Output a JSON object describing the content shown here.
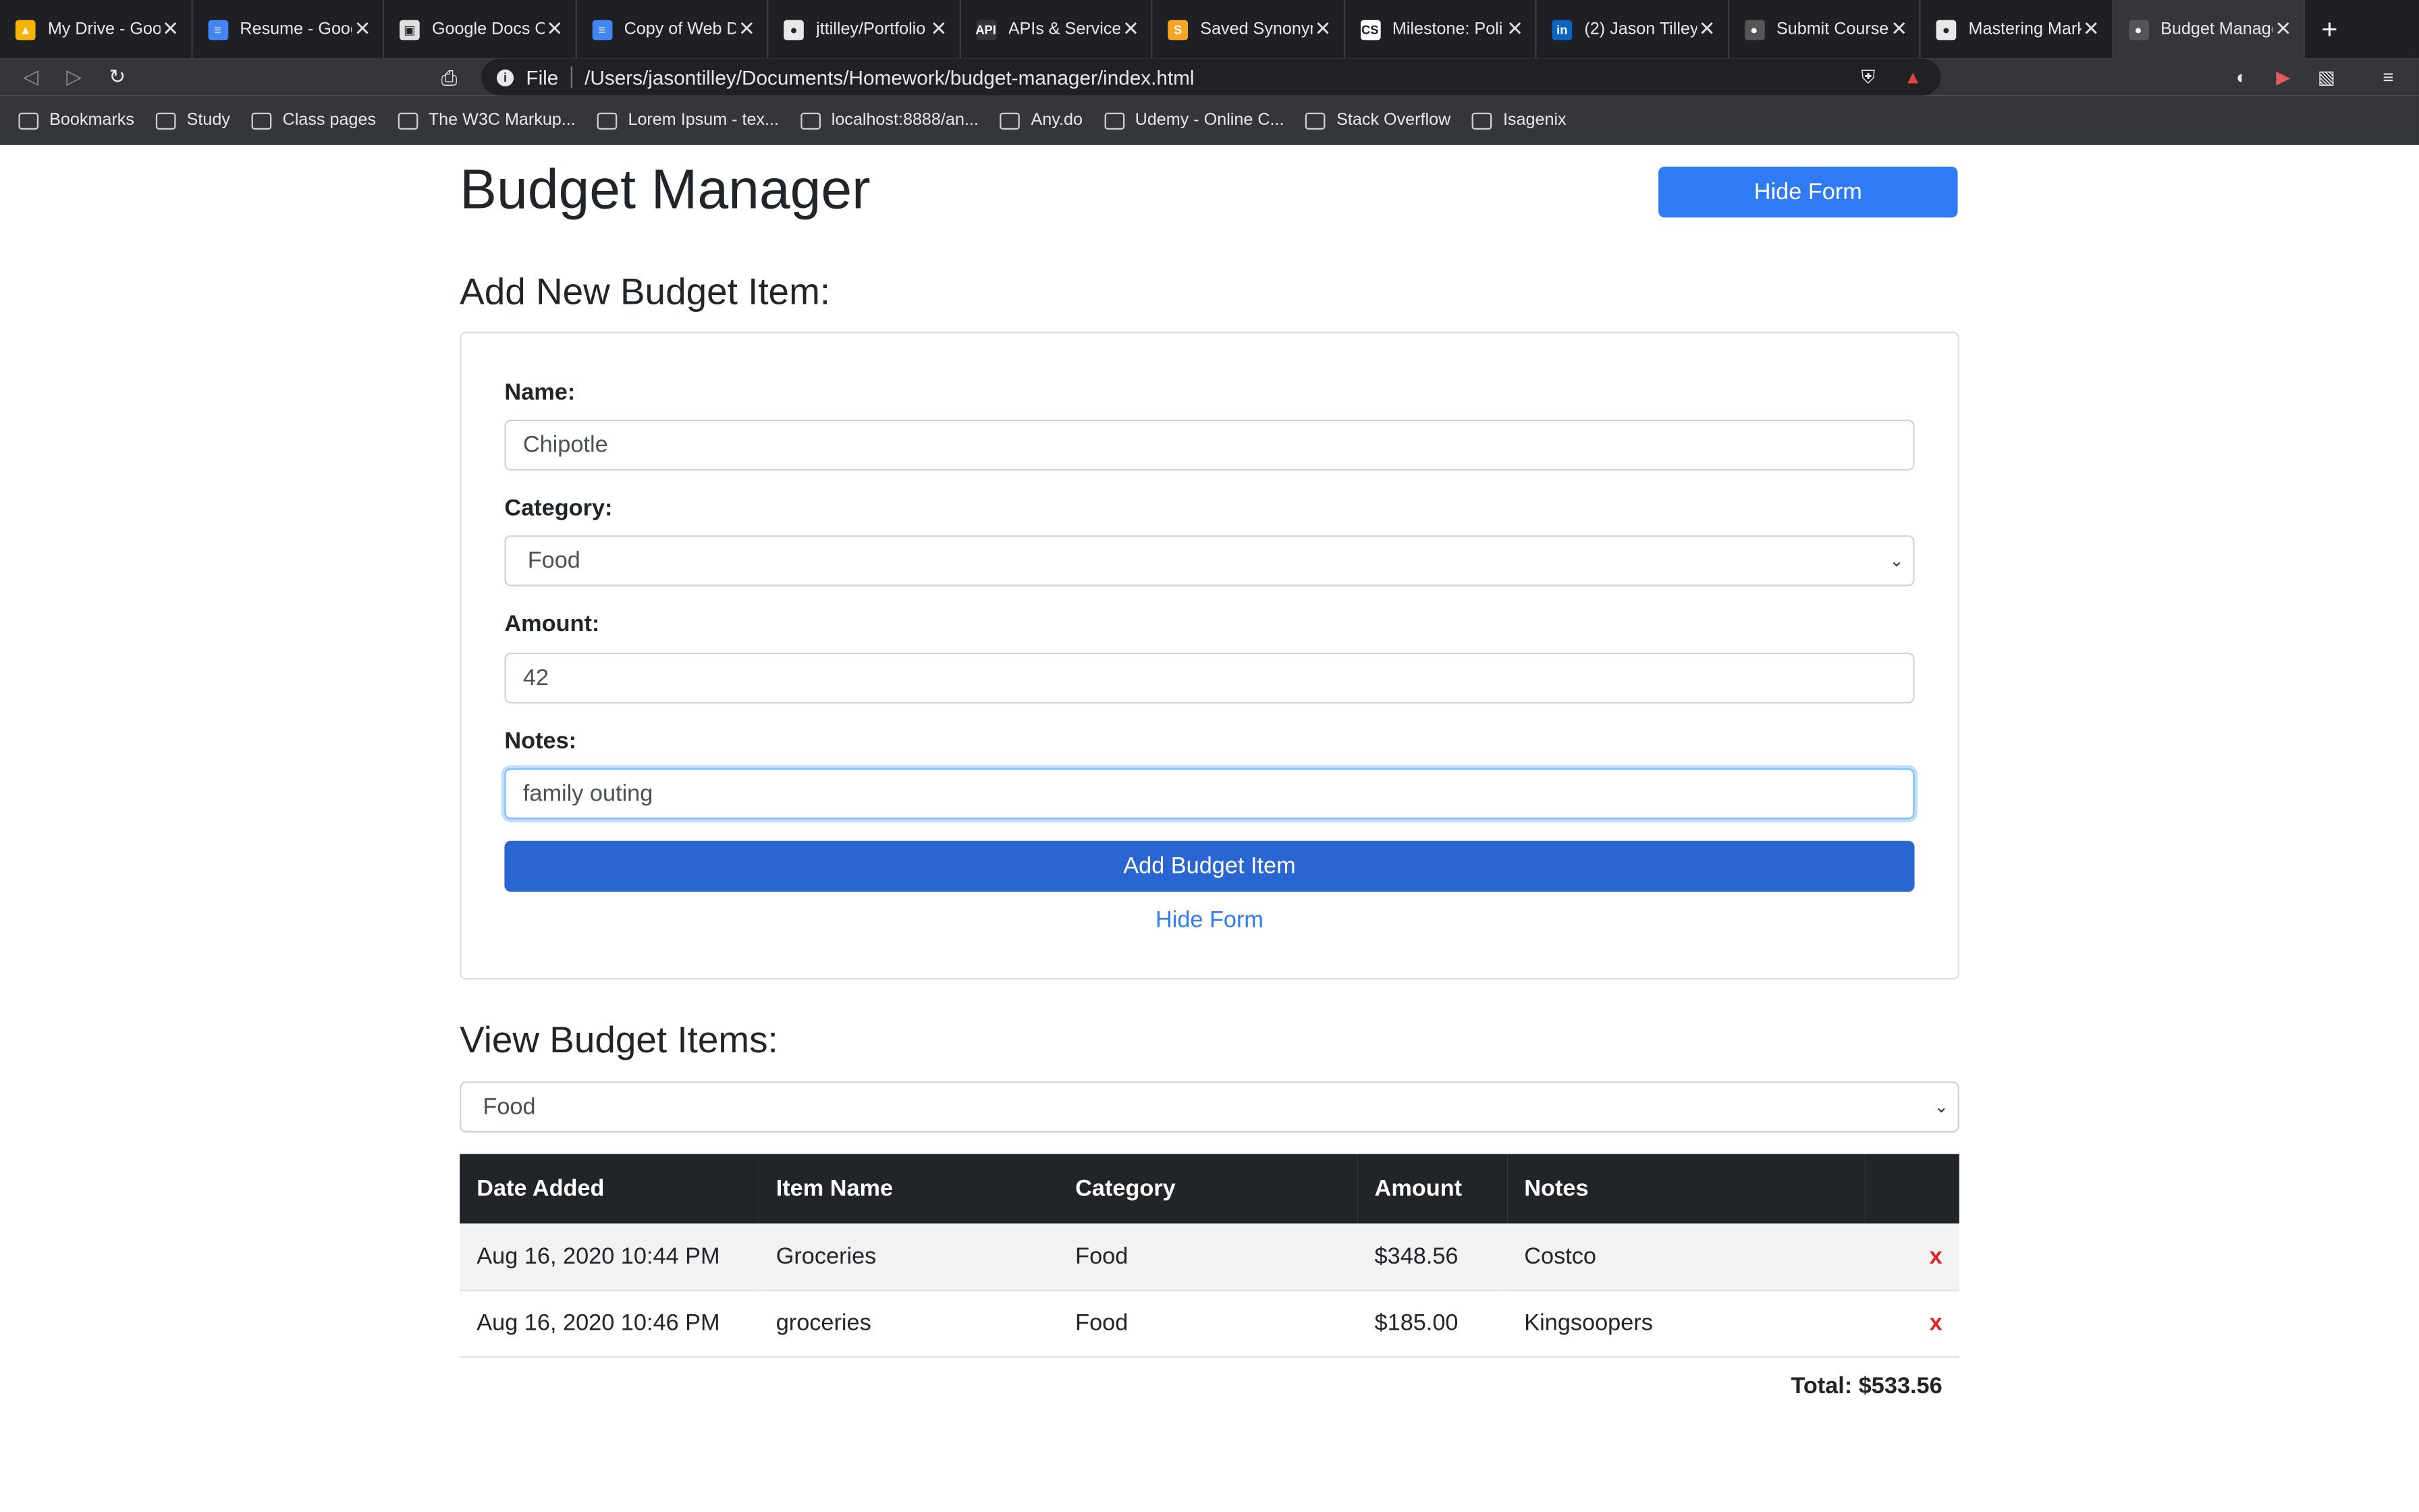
{
  "browser": {
    "tabs": [
      {
        "title": "My Drive - Goo",
        "color": "#f4b400",
        "glyph": "▲"
      },
      {
        "title": "Resume - Goog",
        "color": "#4285f4",
        "glyph": "≡"
      },
      {
        "title": "Google Docs O",
        "color": "#e0e0e0",
        "glyph": "▣"
      },
      {
        "title": "Copy of Web D",
        "color": "#4285f4",
        "glyph": "≡"
      },
      {
        "title": "jttilley/Portfolio",
        "color": "#e8e8e8",
        "glyph": "●"
      },
      {
        "title": "APIs & Services",
        "color": "#35363a",
        "glyph": "API"
      },
      {
        "title": "Saved Synonym",
        "color": "#f6a623",
        "glyph": "S"
      },
      {
        "title": "Milestone: Poli",
        "color": "#ffffff",
        "glyph": "CS"
      },
      {
        "title": "(2) Jason Tilley",
        "color": "#0a66c2",
        "glyph": "in"
      },
      {
        "title": "Submit Course",
        "color": "#555555",
        "glyph": "●"
      },
      {
        "title": "Mastering Mark",
        "color": "#e8e8e8",
        "glyph": "●"
      },
      {
        "title": "Budget Manage",
        "color": "#555555",
        "glyph": "●",
        "active": true
      }
    ],
    "address_scheme": "File",
    "address": "/Users/jasontilley/Documents/Homework/budget-manager/index.html",
    "bookmarks": [
      "Bookmarks",
      "Study",
      "Class pages",
      "The W3C Markup...",
      "Lorem Ipsum - tex...",
      "localhost:8888/an...",
      "Any.do",
      "Udemy - Online C...",
      "Stack Overflow",
      "Isagenix"
    ]
  },
  "header": {
    "title": "Budget Manager",
    "toggle_label": "Hide Form"
  },
  "form": {
    "heading": "Add New Budget Item:",
    "name_label": "Name:",
    "name_value": "Chipotle",
    "category_label": "Category:",
    "category_value": "Food",
    "amount_label": "Amount:",
    "amount_value": "42",
    "notes_label": "Notes:",
    "notes_value": "family outing",
    "submit_label": "Add Budget Item",
    "hide_link": "Hide Form"
  },
  "view": {
    "heading": "View Budget Items:",
    "filter_value": "Food",
    "columns": [
      "Date Added",
      "Item Name",
      "Category",
      "Amount",
      "Notes"
    ],
    "rows": [
      {
        "date": "Aug 16, 2020 10:44 PM",
        "name": "Groceries",
        "category": "Food",
        "amount": "$348.56",
        "notes": "Costco",
        "delete": "x"
      },
      {
        "date": "Aug 16, 2020 10:46 PM",
        "name": "groceries",
        "category": "Food",
        "amount": "$185.00",
        "notes": "Kingsoopers",
        "delete": "x"
      }
    ],
    "total": "Total: $533.56"
  }
}
